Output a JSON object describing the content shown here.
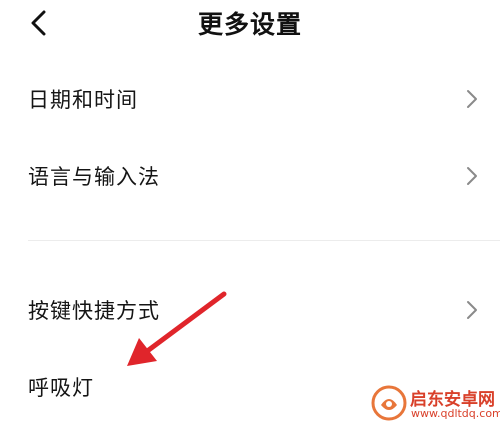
{
  "header": {
    "title": "更多设置",
    "back_icon": "chevron-left-icon"
  },
  "settings": {
    "items": [
      {
        "label": "日期和时间",
        "icon": "chevron-right-icon"
      },
      {
        "label": "语言与输入法",
        "icon": "chevron-right-icon"
      },
      {
        "label": "按键快捷方式",
        "icon": "chevron-right-icon"
      },
      {
        "label": "呼吸灯"
      }
    ]
  },
  "annotation": {
    "arrow_color": "#e0252b"
  },
  "watermark": {
    "name": "启东安卓网",
    "url": "www.qdltdq.com",
    "color": "#d9402a"
  }
}
